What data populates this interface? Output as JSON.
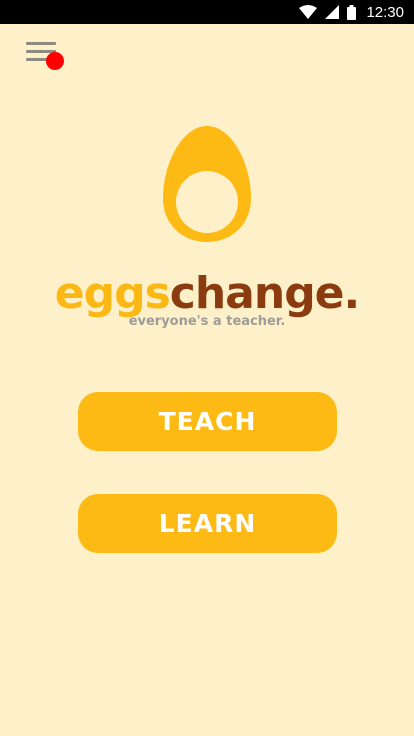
{
  "status_bar": {
    "time": "12:30",
    "icons": [
      "wifi-icon",
      "signal-icon",
      "battery-icon"
    ]
  },
  "header": {
    "menu_icon": "hamburger-menu-icon",
    "notification_color": "#FF0000"
  },
  "brand": {
    "name_part1": "eggs",
    "name_part2": "change.",
    "tagline": "everyone's a teacher."
  },
  "actions": {
    "teach_label": "TEACH",
    "learn_label": "LEARN"
  },
  "colors": {
    "background": "#FEF1C9",
    "accent_yellow": "#FDBA14",
    "brand_brown": "#8B3B10",
    "tagline_gray": "#9E9C98"
  }
}
